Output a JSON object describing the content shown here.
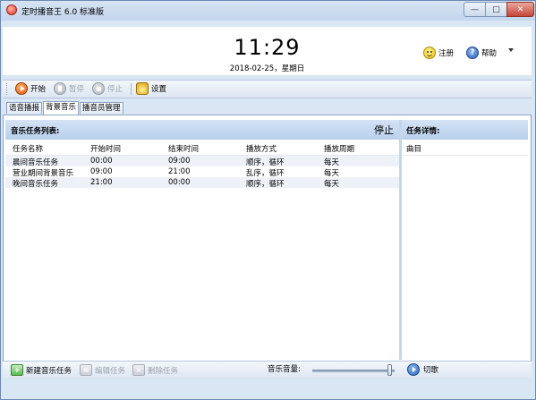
{
  "window": {
    "title": "定时播音王 6.0 标准版",
    "min_icon": "minimize-icon",
    "max_icon": "maximize-icon",
    "close_icon": "close-icon"
  },
  "header": {
    "time": "11:29",
    "date": "2018-02-25，星期日",
    "register_label": "注册",
    "help_label": "帮助"
  },
  "toolbar": {
    "start_label": "开始",
    "pause_label": "暂停",
    "stop_label": "停止",
    "settings_label": "设置"
  },
  "tabs": [
    "语音播报",
    "背景音乐",
    "播音员管理"
  ],
  "active_tab": "背景音乐",
  "music_tasks": {
    "title": "音乐任务列表:",
    "status": "停止",
    "columns": [
      "任务名称",
      "开始时间",
      "结束时间",
      "播放方式",
      "播放周期"
    ],
    "rows": [
      [
        "晨间音乐任务",
        "00:00",
        "09:00",
        "顺序，循环",
        "每天"
      ],
      [
        "营业期间背景音乐",
        "09:00",
        "21:00",
        "乱序，循环",
        "每天"
      ],
      [
        "晚间音乐任务",
        "21:00",
        "00:00",
        "顺序，循环",
        "每天"
      ]
    ]
  },
  "task_detail": {
    "title": "任务详情:",
    "column": "曲目"
  },
  "bottom": {
    "new_task_label": "新建音乐任务",
    "edit_task_label": "编辑任务",
    "delete_task_label": "删除任务",
    "volume_label": "音乐音量:",
    "volume_level": 0.96,
    "cut_song_label": "切歌"
  },
  "colors": {
    "accent": "#2b62b8",
    "header_strip": "#c8dbf1",
    "window_bg": "#d9e6f4"
  }
}
